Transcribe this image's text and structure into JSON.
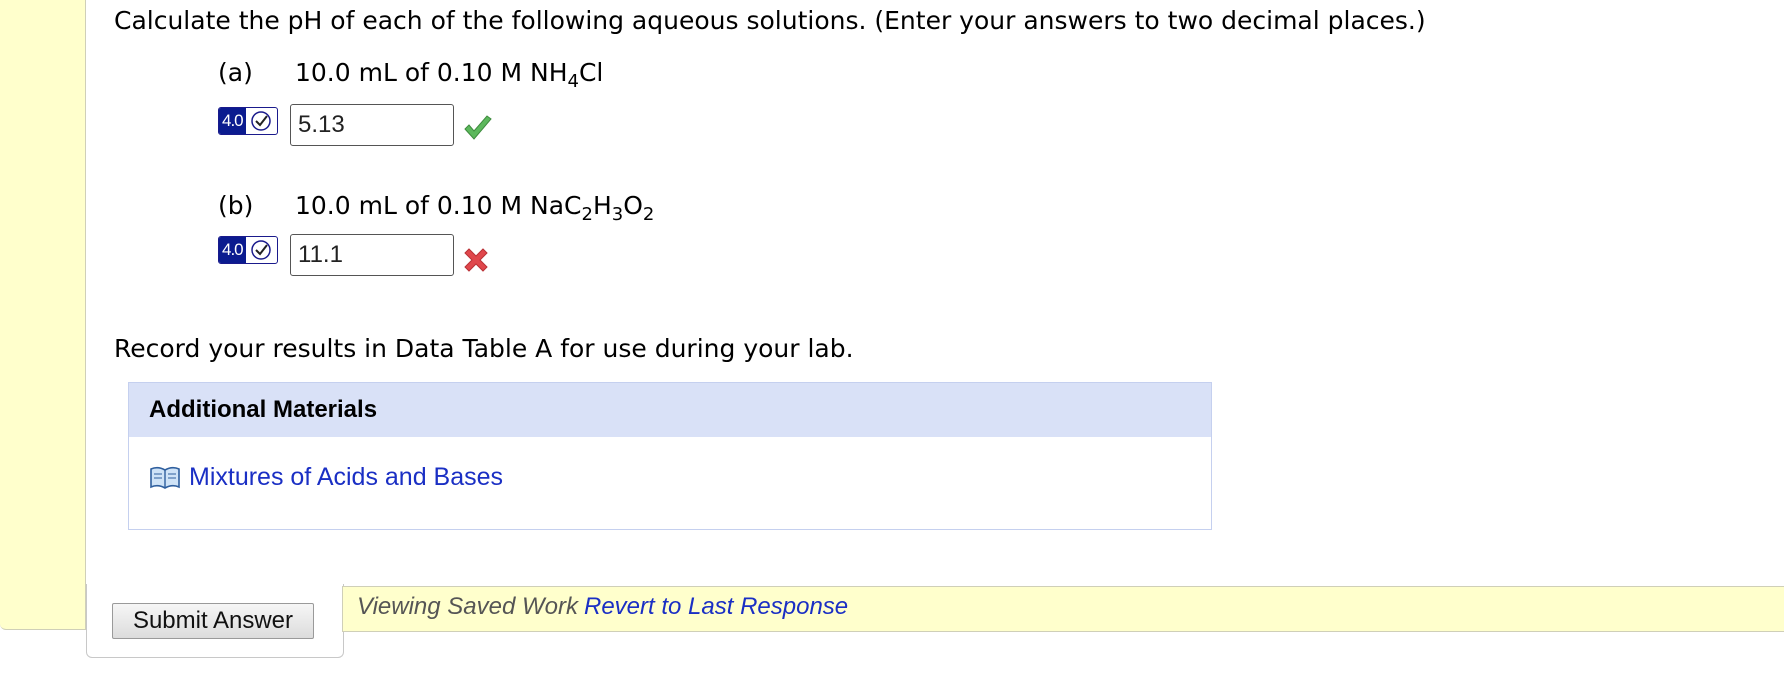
{
  "question": {
    "prompt": "Calculate the pH of each of the following aqueous solutions. (Enter your answers to two decimal places.)",
    "parts": [
      {
        "label": "(a)",
        "text_prefix": "10.0 mL of 0.10 M ",
        "formula": [
          {
            "t": "NH"
          },
          {
            "sub": "4"
          },
          {
            "t": "Cl"
          }
        ],
        "points_badge": "4.0",
        "answer": "5.13",
        "status": "correct",
        "status_icon": "check-icon"
      },
      {
        "label": "(b)",
        "text_prefix": "10.0 mL of 0.10 M ",
        "formula": [
          {
            "t": "NaC"
          },
          {
            "sub": "2"
          },
          {
            "t": "H"
          },
          {
            "sub": "3"
          },
          {
            "t": "O"
          },
          {
            "sub": "2"
          }
        ],
        "points_badge": "4.0",
        "answer": "11.1",
        "status": "incorrect",
        "status_icon": "x-icon"
      }
    ],
    "record_note": "Record your results in Data Table A for use during your lab."
  },
  "additional_materials": {
    "header": "Additional Materials",
    "links": [
      {
        "label": "Mixtures of Acids and Bases",
        "icon": "book-icon"
      }
    ]
  },
  "footer": {
    "submit_label": "Submit Answer",
    "viewing_text": "Viewing Saved Work",
    "revert_link": "Revert to Last Response"
  },
  "colors": {
    "panel_yellow": "#ffffcc",
    "badge_blue": "#0b1b8f",
    "link_blue": "#1a2fc4",
    "correct_green": "#5cb85c",
    "incorrect_red": "#e0474c",
    "materials_header_bg": "#d9e1f7"
  }
}
